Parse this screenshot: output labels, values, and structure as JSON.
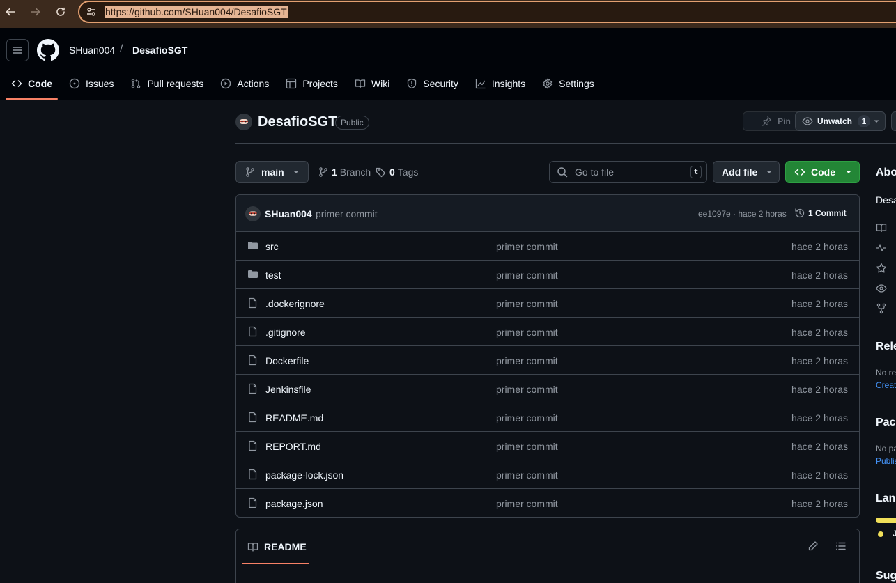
{
  "browser": {
    "url": "https://github.com/SHuan004/DesafioSGT",
    "back_icon": "back-arrow-icon",
    "forward_icon": "forward-arrow-icon",
    "reload_icon": "reload-icon"
  },
  "header": {
    "owner": "SHuan004",
    "separator": "/",
    "repo": "DesafioSGT"
  },
  "repo_nav": {
    "tabs": [
      {
        "label": "Code",
        "icon": "code-icon",
        "active": true
      },
      {
        "label": "Issues",
        "icon": "issue-icon"
      },
      {
        "label": "Pull requests",
        "icon": "pull-request-icon"
      },
      {
        "label": "Actions",
        "icon": "play-icon"
      },
      {
        "label": "Projects",
        "icon": "table-icon"
      },
      {
        "label": "Wiki",
        "icon": "book-icon"
      },
      {
        "label": "Security",
        "icon": "shield-icon"
      },
      {
        "label": "Insights",
        "icon": "graph-icon"
      },
      {
        "label": "Settings",
        "icon": "gear-icon"
      }
    ]
  },
  "repo": {
    "title": "DesafioSGT",
    "visibility": "Public",
    "pin_label": "Pin",
    "watch_label": "Unwatch",
    "watch_count": "1"
  },
  "toolbar": {
    "branch": "main",
    "branches_count": "1",
    "branches_label": "Branch",
    "tags_count": "0",
    "tags_label": "Tags",
    "goto_placeholder": "Go to file",
    "goto_shortcut": "t",
    "add_file_label": "Add file",
    "code_label": "Code"
  },
  "latest_commit": {
    "author": "SHuan004",
    "message": "primer commit",
    "meta": "ee1097e · hace 2 horas",
    "commits_label": "1 Commit"
  },
  "files": [
    {
      "name": "src",
      "type": "folder",
      "commit": "primer commit",
      "age": "hace 2 horas"
    },
    {
      "name": "test",
      "type": "folder",
      "commit": "primer commit",
      "age": "hace 2 horas"
    },
    {
      "name": ".dockerignore",
      "type": "file",
      "commit": "primer commit",
      "age": "hace 2 horas"
    },
    {
      "name": ".gitignore",
      "type": "file",
      "commit": "primer commit",
      "age": "hace 2 horas"
    },
    {
      "name": "Dockerfile",
      "type": "file",
      "commit": "primer commit",
      "age": "hace 2 horas"
    },
    {
      "name": "Jenkinsfile",
      "type": "file",
      "commit": "primer commit",
      "age": "hace 2 horas"
    },
    {
      "name": "README.md",
      "type": "file",
      "commit": "primer commit",
      "age": "hace 2 horas"
    },
    {
      "name": "REPORT.md",
      "type": "file",
      "commit": "primer commit",
      "age": "hace 2 horas"
    },
    {
      "name": "package-lock.json",
      "type": "file",
      "commit": "primer commit",
      "age": "hace 2 horas"
    },
    {
      "name": "package.json",
      "type": "file",
      "commit": "primer commit",
      "age": "hace 2 horas"
    }
  ],
  "readme": {
    "tab_label": "README"
  },
  "sidebar": {
    "about_heading": "Abo",
    "about_text": "Desa",
    "releases_heading": "Rele",
    "releases_text": "No re",
    "releases_link": "Creat",
    "packages_heading": "Pack",
    "packages_text": "No pa",
    "packages_link": "Publis",
    "languages_heading": "Lang",
    "language_name": "J",
    "suggested_heading": "Sug",
    "language_color": "#f1e05a"
  },
  "colors": {
    "accent_underline": "#f78166",
    "primary_button": "#238636",
    "link": "#4493f8"
  }
}
